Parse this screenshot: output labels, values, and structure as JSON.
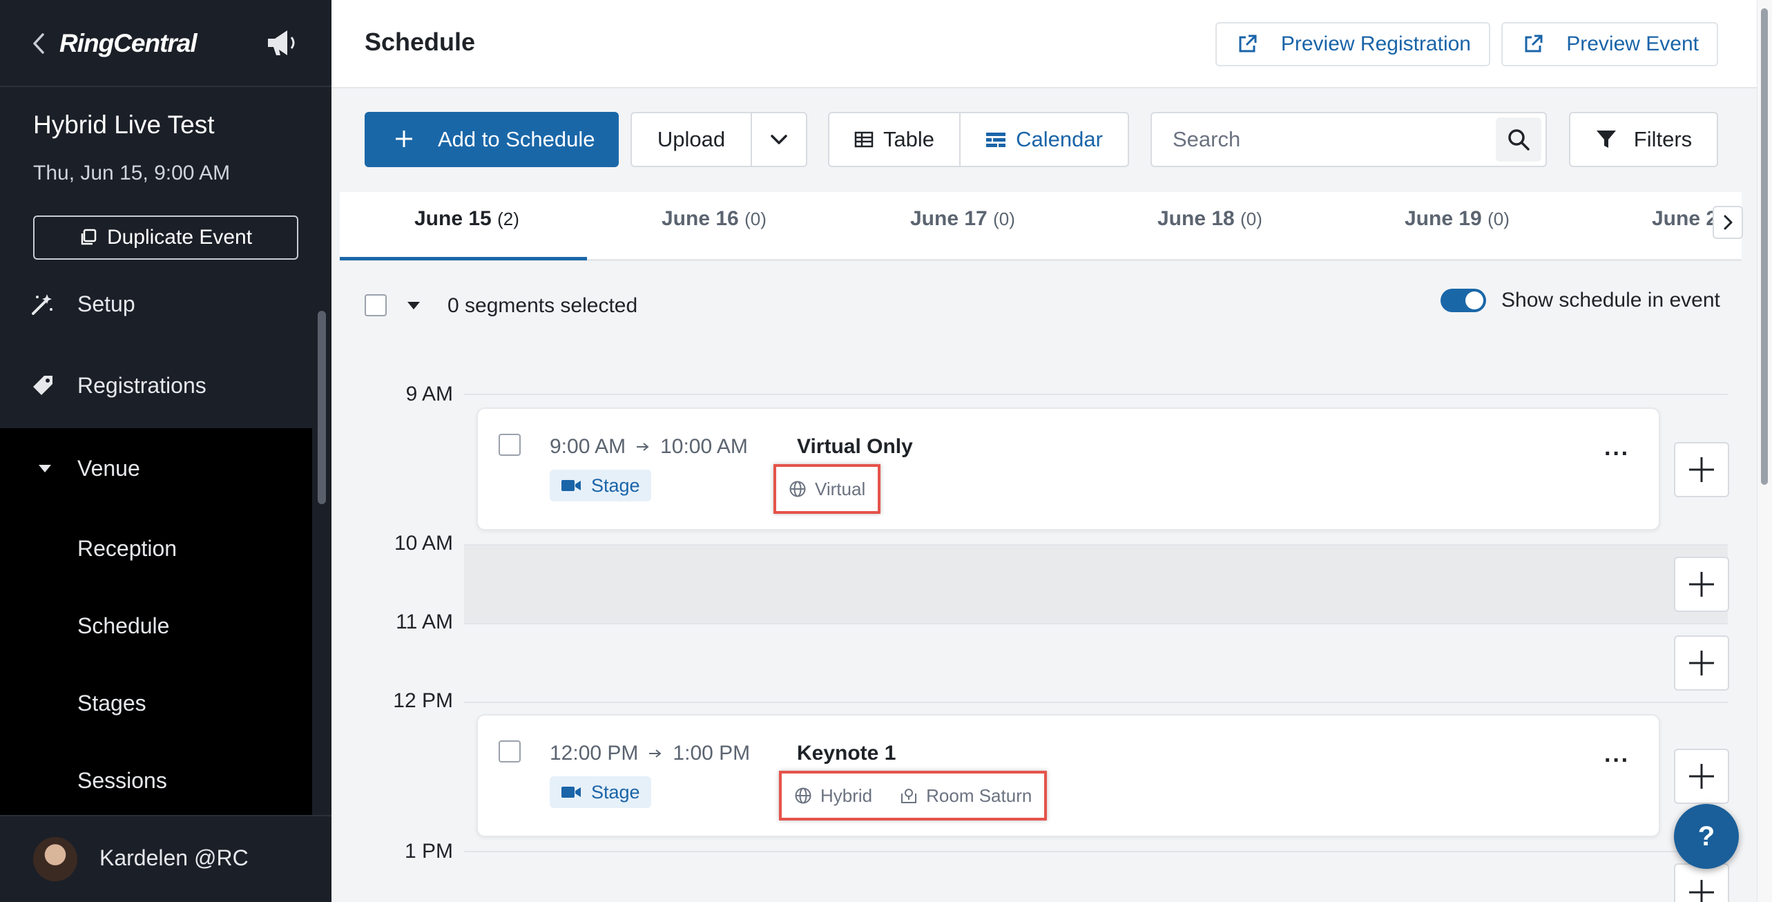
{
  "sidebar": {
    "back_icon": "chevron-left-icon",
    "logo": "RingCentral",
    "announce_icon": "megaphone-icon",
    "event_name": "Hybrid Live Test",
    "event_date": "Thu, Jun 15, 9:00 AM",
    "duplicate_label": "Duplicate Event",
    "nav": {
      "setup": "Setup",
      "registrations": "Registrations",
      "venue": "Venue",
      "reception": "Reception",
      "schedule": "Schedule",
      "stages": "Stages",
      "sessions": "Sessions"
    },
    "user_name": "Kardelen @RC"
  },
  "header": {
    "title": "Schedule",
    "preview_registration": "Preview Registration",
    "preview_event": "Preview Event"
  },
  "toolbar": {
    "add_label": "Add to Schedule",
    "upload_label": "Upload",
    "table_label": "Table",
    "calendar_label": "Calendar",
    "search_placeholder": "Search",
    "filters_label": "Filters"
  },
  "tabs": [
    {
      "date": "June 15",
      "count": "(2)"
    },
    {
      "date": "June 16",
      "count": "(0)"
    },
    {
      "date": "June 17",
      "count": "(0)"
    },
    {
      "date": "June 18",
      "count": "(0)"
    },
    {
      "date": "June 19",
      "count": "(0)"
    },
    {
      "date": "June 2",
      "count": ""
    }
  ],
  "selection": {
    "text": "0 segments selected",
    "show_schedule_label": "Show schedule in event",
    "show_schedule_on": true
  },
  "hours": [
    "9 AM",
    "10 AM",
    "11 AM",
    "12 PM",
    "1 PM"
  ],
  "segments": [
    {
      "start": "9:00 AM",
      "end": "10:00 AM",
      "title": "Virtual Only",
      "stage": "Stage",
      "format": "Virtual",
      "room": ""
    },
    {
      "start": "12:00 PM",
      "end": "1:00 PM",
      "title": "Keynote 1",
      "stage": "Stage",
      "format": "Hybrid",
      "room": "Room Saturn"
    }
  ],
  "help_label": "?",
  "colors": {
    "primary": "#1a67a8",
    "sidebar_bg": "#1b1f27",
    "highlight": "#e5534b"
  }
}
